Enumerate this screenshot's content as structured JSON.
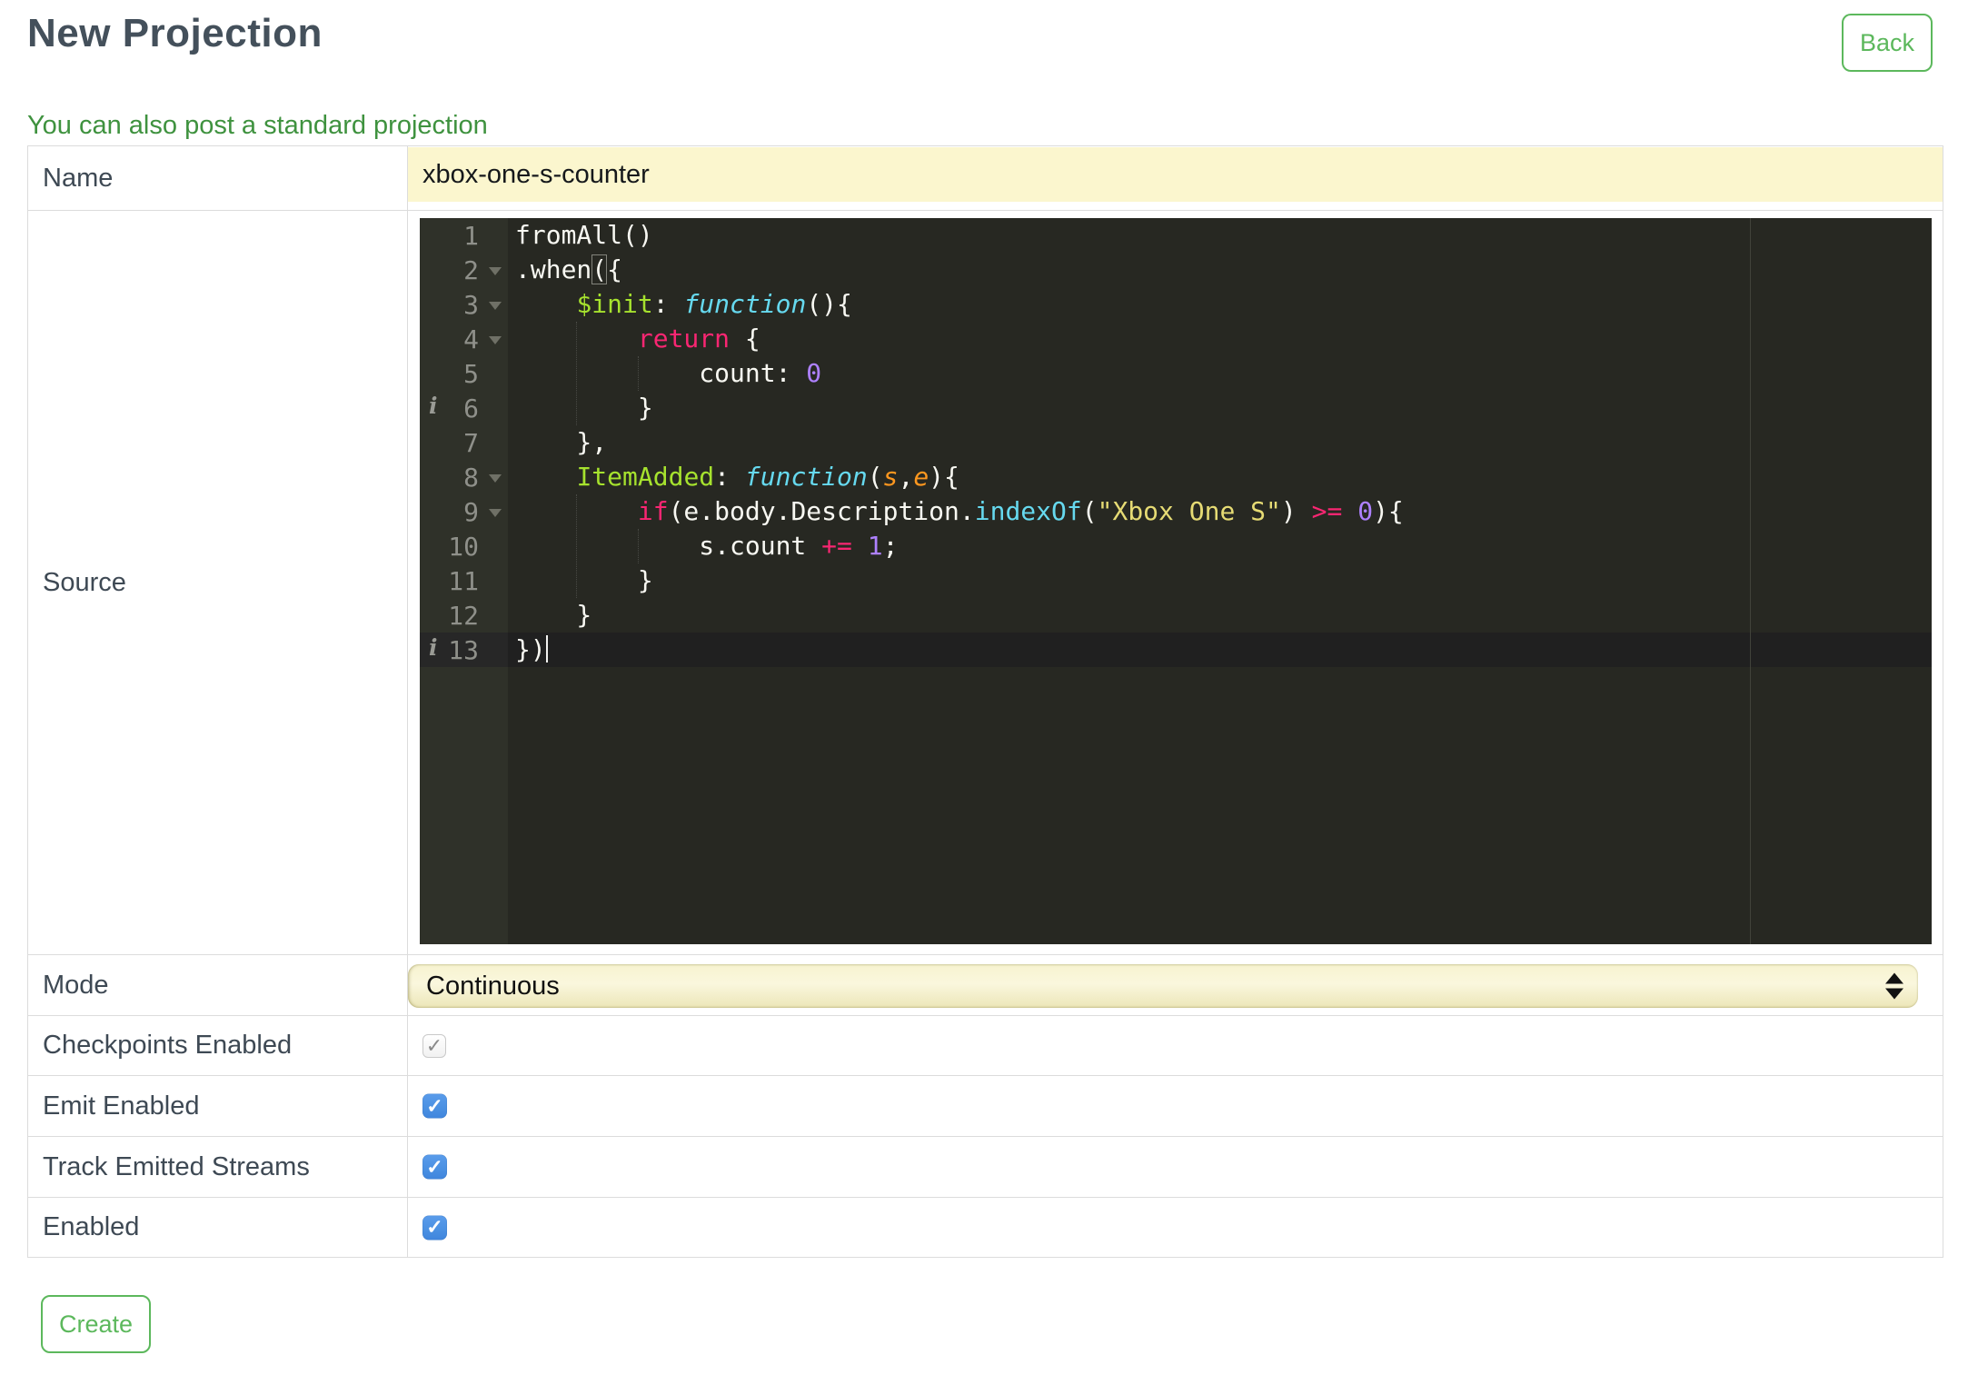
{
  "header": {
    "title": "New Projection",
    "back_label": "Back"
  },
  "link": {
    "text": "You can also post a standard projection"
  },
  "form": {
    "labels": {
      "name": "Name",
      "source": "Source",
      "mode": "Mode",
      "checkpoints": "Checkpoints Enabled",
      "emit": "Emit Enabled",
      "track": "Track Emitted Streams",
      "enabled": "Enabled"
    },
    "name_value": "xbox-one-s-counter",
    "mode_value": "Continuous",
    "checkboxes": {
      "checkpoints": {
        "checked": true,
        "disabled": true
      },
      "emit": {
        "checked": true,
        "disabled": false
      },
      "track": {
        "checked": true,
        "disabled": false
      },
      "enabled": {
        "checked": true,
        "disabled": false
      }
    }
  },
  "buttons": {
    "create_label": "Create"
  },
  "icons": {
    "checkmark": "✓",
    "info": "i"
  },
  "colors": {
    "accent_green": "#5cb85c",
    "link_green": "#3f923f",
    "heading_slate": "#44505b",
    "input_yellow": "#fbf6ce",
    "checkbox_blue": "#4a90e2",
    "editor_background": "#272822",
    "editor_gutter": "#2f3129"
  },
  "editor": {
    "lines": [
      {
        "no": 1,
        "segments": [
          {
            "t": "fromAll()"
          }
        ]
      },
      {
        "no": 2,
        "fold": true,
        "segments": [
          {
            "t": ".when"
          },
          {
            "t": "(",
            "cls": "match"
          },
          {
            "t": "{"
          }
        ]
      },
      {
        "no": 3,
        "fold": true,
        "segments": [
          {
            "t": "    "
          },
          {
            "t": "$init",
            "cls": "green"
          },
          {
            "t": ": "
          },
          {
            "t": "function",
            "cls": "cyani"
          },
          {
            "t": "(){"
          }
        ]
      },
      {
        "no": 4,
        "fold": true,
        "segments": [
          {
            "t": "        "
          },
          {
            "t": "return",
            "cls": "pink"
          },
          {
            "t": " {"
          }
        ]
      },
      {
        "no": 5,
        "segments": [
          {
            "t": "            count: "
          },
          {
            "t": "0",
            "cls": "purple"
          }
        ]
      },
      {
        "no": 6,
        "info": true,
        "segments": [
          {
            "t": "        }"
          }
        ]
      },
      {
        "no": 7,
        "segments": [
          {
            "t": "    },"
          }
        ]
      },
      {
        "no": 8,
        "fold": true,
        "segments": [
          {
            "t": "    "
          },
          {
            "t": "ItemAdded",
            "cls": "green"
          },
          {
            "t": ": "
          },
          {
            "t": "function",
            "cls": "cyani"
          },
          {
            "t": "("
          },
          {
            "t": "s",
            "cls": "orangei"
          },
          {
            "t": ","
          },
          {
            "t": "e",
            "cls": "orangei"
          },
          {
            "t": "){"
          }
        ]
      },
      {
        "no": 9,
        "fold": true,
        "segments": [
          {
            "t": "        "
          },
          {
            "t": "if",
            "cls": "pink"
          },
          {
            "t": "(e.body.Description."
          },
          {
            "t": "indexOf",
            "cls": "cyan"
          },
          {
            "t": "("
          },
          {
            "t": "\"Xbox One S\"",
            "cls": "yellow"
          },
          {
            "t": ") "
          },
          {
            "t": ">=",
            "cls": "pink"
          },
          {
            "t": " "
          },
          {
            "t": "0",
            "cls": "purple"
          },
          {
            "t": "){"
          }
        ]
      },
      {
        "no": 10,
        "segments": [
          {
            "t": "            s.count "
          },
          {
            "t": "+=",
            "cls": "pink"
          },
          {
            "t": " "
          },
          {
            "t": "1",
            "cls": "purple"
          },
          {
            "t": ";"
          }
        ]
      },
      {
        "no": 11,
        "segments": [
          {
            "t": "        }"
          }
        ]
      },
      {
        "no": 12,
        "segments": [
          {
            "t": "    }"
          }
        ]
      },
      {
        "no": 13,
        "info": true,
        "active": true,
        "cursor": true,
        "segments": [
          {
            "t": "})"
          }
        ]
      }
    ]
  }
}
